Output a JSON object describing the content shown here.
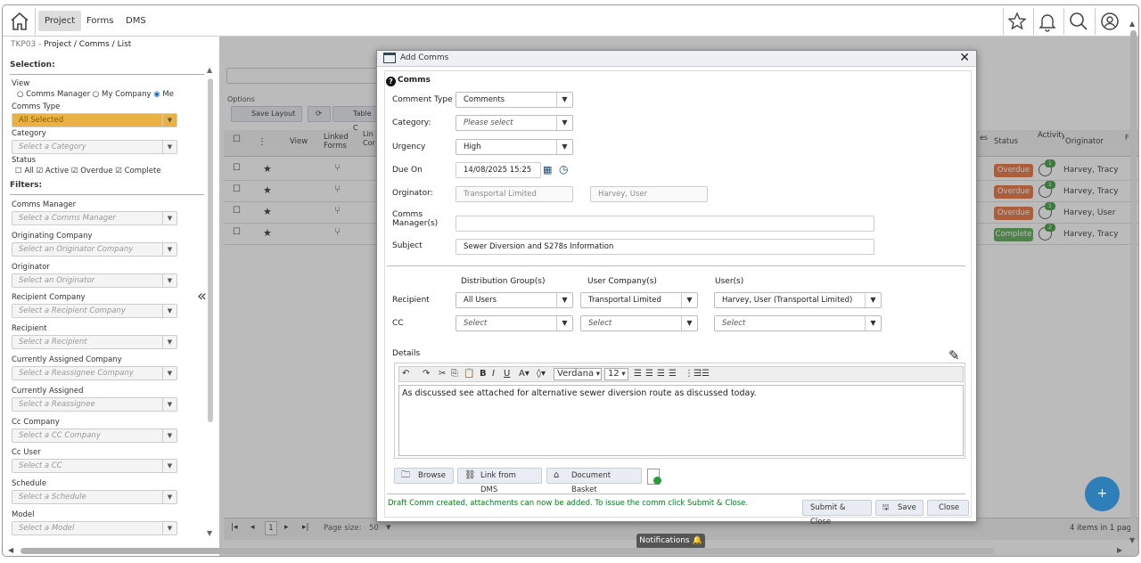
{
  "topbar": {
    "tabs": [
      "Project",
      "Forms",
      "DMS"
    ],
    "active_tab": "Project",
    "icons": [
      "home-icon",
      "star-icon",
      "bell-icon",
      "search-icon",
      "user-icon"
    ]
  },
  "breadcrumb": {
    "code": "TKP03 -",
    "path": "Project / Comms / List"
  },
  "sidebar": {
    "selection_heading": "Selection:",
    "view_label": "View",
    "view_options": [
      "Comms Manager",
      "My Company",
      "Me"
    ],
    "comms_type_label": "Comms Type",
    "comms_type_value": "All Selected",
    "category_label": "Category",
    "category_placeholder": "Select a Category",
    "status_label": "Status",
    "status_options": [
      "All",
      "Active",
      "Overdue",
      "Complete"
    ],
    "filters_heading": "Filters:",
    "filters": [
      {
        "label": "Comms Manager",
        "placeholder": "Select a Comms Manager"
      },
      {
        "label": "Originating Company",
        "placeholder": "Select an Originator Company"
      },
      {
        "label": "Originator",
        "placeholder": "Select an Originator"
      },
      {
        "label": "Recipient Company",
        "placeholder": "Select a Recipient Company"
      },
      {
        "label": "Recipient",
        "placeholder": "Select a Recipient"
      },
      {
        "label": "Currently Assigned Company",
        "placeholder": "Select a Reassignee Company"
      },
      {
        "label": "Currently Assigned",
        "placeholder": "Select a Reassignee"
      },
      {
        "label": "Cc Company",
        "placeholder": "Select a CC Company"
      },
      {
        "label": "Cc User",
        "placeholder": "Select a CC"
      },
      {
        "label": "Schedule",
        "placeholder": "Select a Schedule"
      },
      {
        "label": "Model",
        "placeholder": "Select a Model"
      }
    ]
  },
  "grid": {
    "options_label": "Options",
    "save_layout": "Save Layout",
    "table_label": "Table C",
    "columns": [
      "View",
      "Linked Forms",
      "Lin Cor",
      "Status",
      "Activity",
      "Originator",
      "es",
      "F"
    ],
    "rows": [
      {
        "status": "Overdue",
        "status_color": "#e8703a",
        "activity": "1",
        "originator": "Harvey, Tracy"
      },
      {
        "status": "Overdue",
        "status_color": "#e8703a",
        "activity": "1",
        "originator": "Harvey, Tracy"
      },
      {
        "status": "Overdue",
        "status_color": "#e8703a",
        "activity": "1",
        "originator": "Harvey, User"
      },
      {
        "status": "Complete",
        "status_color": "#5aa652",
        "activity": "2",
        "originator": "Harvey, Tracy"
      }
    ],
    "page": "1",
    "page_size_label": "Page size:",
    "page_size": "50",
    "items_info": "4 items in 1 page"
  },
  "modal": {
    "title": "Add Comms",
    "section": "Comms",
    "fields": {
      "comment_type": {
        "label": "Comment Type",
        "value": "Comments"
      },
      "category": {
        "label": "Category:",
        "value": "Please select"
      },
      "urgency": {
        "label": "Urgency",
        "value": "High"
      },
      "due_on": {
        "label": "Due On",
        "value": "14/08/2025 15:25"
      },
      "originator": {
        "label": "Orginator:",
        "company": "Transportal Limited",
        "user": "Harvey, User"
      },
      "comms_manager": {
        "label1": "Comms",
        "label2": "Manager(s)",
        "value": ""
      },
      "subject": {
        "label": "Subject",
        "value": "Sewer Diversion and S278s Information"
      }
    },
    "distribution": {
      "headers": [
        "Distribution Group(s)",
        "User Company(s)",
        "User(s)"
      ],
      "recipient_label": "Recipient",
      "recipient": [
        "All Users",
        "Transportal Limited",
        "Harvey, User (Transportal Limited)"
      ],
      "cc_label": "CC",
      "cc": [
        "Select",
        "Select",
        "Select"
      ]
    },
    "details_label": "Details",
    "editor_font": "Verdana",
    "editor_size": "12",
    "editor_text": "As discussed see attached for alternative sewer diversion route as discussed today.",
    "attach_buttons": [
      "Browse",
      "Link from DMS",
      "Document Basket"
    ],
    "footer_message": "Draft Comm created, attachments can now be added. To issue the comm click Submit & Close.",
    "actions": [
      "Submit & Close",
      "Save",
      "Close"
    ]
  },
  "notifications_label": "Notifications",
  "fab_label": "+"
}
